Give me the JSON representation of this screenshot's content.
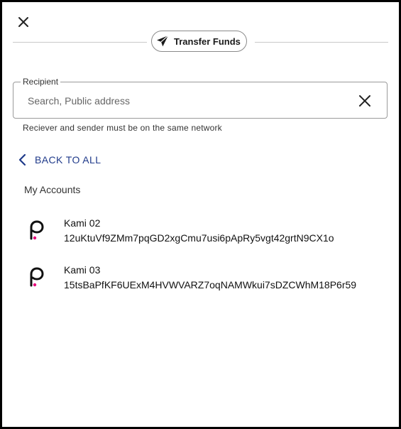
{
  "header": {
    "close_icon": "close-icon",
    "title": "Transfer Funds",
    "title_icon": "paper-plane-icon"
  },
  "recipient": {
    "legend": "Recipient",
    "value": "",
    "placeholder": "Search, Public address",
    "clear_icon": "close-icon",
    "helper_text": "Reciever and sender must be on the same network"
  },
  "navigation": {
    "back_label": "BACK TO ALL",
    "back_icon": "chevron-left-icon"
  },
  "accounts_section": {
    "title": "My Accounts",
    "items": [
      {
        "name": "Kami 02",
        "address": "12uKtuVf9ZMm7pqGD2xgCmu7usi6pApRy5vgt42grtN9CX1o",
        "icon": "polkadot-icon"
      },
      {
        "name": "Kami 03",
        "address": "15tsBaPfKF6UExM4HVWVARZ7oqNAMWkui7sDZCWhM18P6r59",
        "icon": "polkadot-icon"
      }
    ]
  },
  "colors": {
    "link": "#1f3a8a",
    "border": "#9a9a9a",
    "polkadot_dot": "#e6007a",
    "frame": "#000000"
  }
}
